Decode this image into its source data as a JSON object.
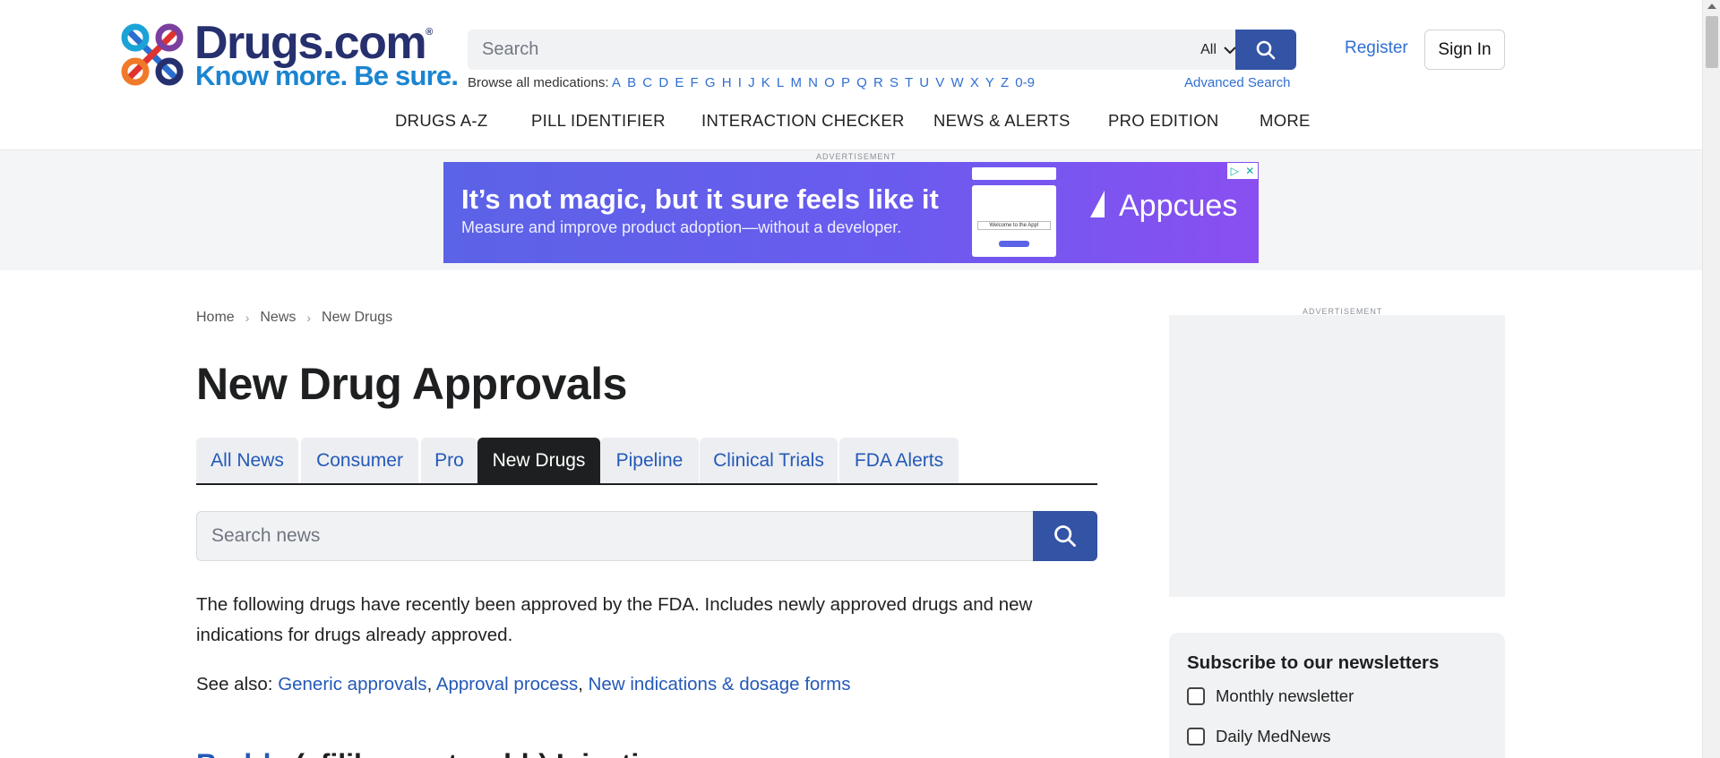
{
  "logo": {
    "name": "Drugs.com",
    "reg": "®",
    "tagline": "Know more. Be sure."
  },
  "search": {
    "placeholder": "Search",
    "scope": "All"
  },
  "browse": {
    "label": "Browse all medications:",
    "letters": [
      "A",
      "B",
      "C",
      "D",
      "E",
      "F",
      "G",
      "H",
      "I",
      "J",
      "K",
      "L",
      "M",
      "N",
      "O",
      "P",
      "Q",
      "R",
      "S",
      "T",
      "U",
      "V",
      "W",
      "X",
      "Y",
      "Z",
      "0-9"
    ]
  },
  "advanced_search": "Advanced Search",
  "auth": {
    "register": "Register",
    "signin": "Sign In"
  },
  "nav": {
    "drugs": "DRUGS A-Z",
    "pill": "PILL IDENTIFIER",
    "interaction": "INTERACTION CHECKER",
    "news": "NEWS & ALERTS",
    "pro": "PRO EDITION",
    "more": "MORE"
  },
  "ads": {
    "label": "ADVERTISEMENT",
    "headline": "It’s not magic, but it sure feels like it",
    "subline": "Measure and improve product  adoption—without a developer.",
    "card_text": "Welcome to the App!",
    "brand": "Appcues"
  },
  "breadcrumb": {
    "home": "Home",
    "news": "News",
    "current": "New Drugs"
  },
  "page_title": "New Drug Approvals",
  "tabs": {
    "all": "All News",
    "consumer": "Consumer",
    "pro": "Pro",
    "new": "New Drugs",
    "pipeline": "Pipeline",
    "trials": "Clinical Trials",
    "fda": "FDA Alerts"
  },
  "news_search": {
    "placeholder": "Search news"
  },
  "intro": "The following drugs have recently been approved by the FDA. Includes newly approved drugs and new indications for drugs already approved.",
  "see_also": {
    "label": "See also:",
    "generic": "Generic approvals",
    "process": "Approval process",
    "indications": "New indications & dosage forms"
  },
  "next_article": {
    "link": "Bodrly",
    "rest": " (afilibercept-mrbb) Injection"
  },
  "newsletter": {
    "title": "Subscribe to our newsletters",
    "monthly": "Monthly newsletter",
    "daily": "Daily MedNews"
  },
  "colors": {
    "brand_navy": "#27306e",
    "brand_blue": "#1a85d1",
    "button_blue": "#3353a5",
    "link_blue": "#2459b8"
  }
}
